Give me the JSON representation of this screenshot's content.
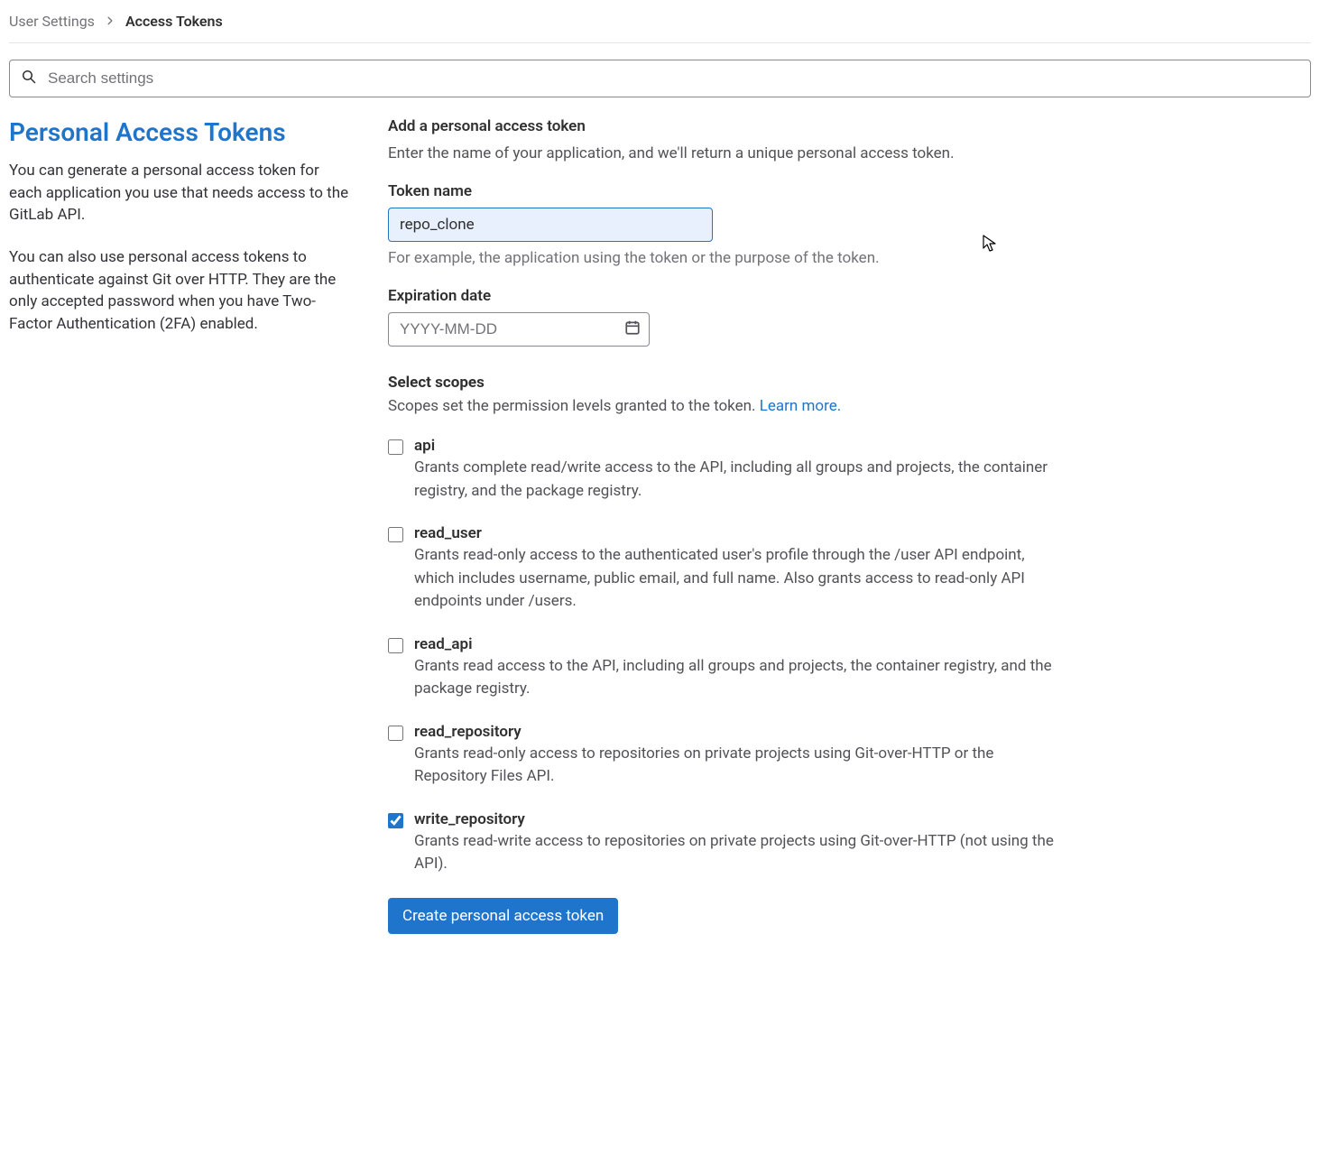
{
  "breadcrumb": {
    "parent": "User Settings",
    "current": "Access Tokens"
  },
  "search": {
    "placeholder": "Search settings"
  },
  "sidebar": {
    "title": "Personal Access Tokens",
    "para1": "You can generate a personal access token for each application you use that needs access to the GitLab API.",
    "para2": "You can also use personal access tokens to authenticate against Git over HTTP. They are the only accepted password when you have Two-Factor Authentication (2FA) enabled."
  },
  "form": {
    "heading": "Add a personal access token",
    "sub": "Enter the name of your application, and we'll return a unique personal access token.",
    "token_name": {
      "label": "Token name",
      "value": "repo_clone",
      "help": "For example, the application using the token or the purpose of the token."
    },
    "expiration": {
      "label": "Expiration date",
      "placeholder": "YYYY-MM-DD"
    },
    "scopes": {
      "heading": "Select scopes",
      "sub_prefix": "Scopes set the permission levels granted to the token. ",
      "learn_more": "Learn more.",
      "items": [
        {
          "name": "api",
          "checked": false,
          "desc": "Grants complete read/write access to the API, including all groups and projects, the container registry, and the package registry."
        },
        {
          "name": "read_user",
          "checked": false,
          "desc": "Grants read-only access to the authenticated user's profile through the /user API endpoint, which includes username, public email, and full name. Also grants access to read-only API endpoints under /users."
        },
        {
          "name": "read_api",
          "checked": false,
          "desc": "Grants read access to the API, including all groups and projects, the container registry, and the package registry."
        },
        {
          "name": "read_repository",
          "checked": false,
          "desc": "Grants read-only access to repositories on private projects using Git-over-HTTP or the Repository Files API."
        },
        {
          "name": "write_repository",
          "checked": true,
          "desc": "Grants read-write access to repositories on private projects using Git-over-HTTP (not using the API)."
        }
      ]
    },
    "submit": "Create personal access token"
  }
}
